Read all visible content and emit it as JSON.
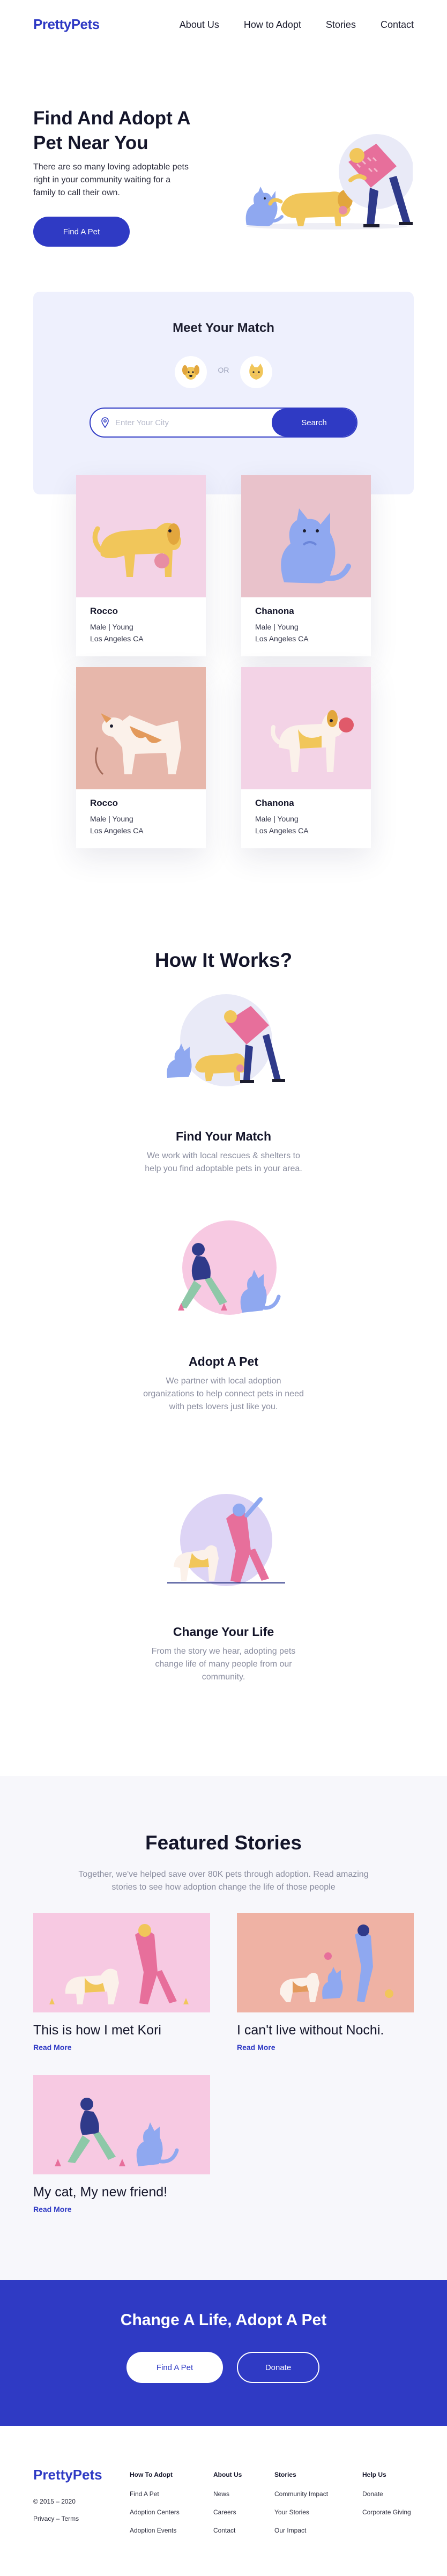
{
  "brand": {
    "logo": "PrettyPets"
  },
  "nav": {
    "items": [
      "About Us",
      "How to  Adopt",
      "Stories",
      "Contact"
    ]
  },
  "hero": {
    "title": "Find And Adopt A Pet Near You",
    "text": "There are so many loving adoptable pets right in your community waiting for a family to call their own.",
    "button": "Find A Pet"
  },
  "match": {
    "title": "Meet Your Match",
    "or_label": "OR",
    "search_placeholder": "Enter Your City",
    "search_button": "Search",
    "pet_icons": [
      "dog-icon",
      "cat-icon"
    ]
  },
  "pets": [
    {
      "name": "Rocco",
      "details": "Male |  Young",
      "location": "Los Angeles CA",
      "bg": "#f3d3e6"
    },
    {
      "name": "Chanona",
      "details": "Male |  Young",
      "location": "Los Angeles CA",
      "bg": "#e9c2cb"
    },
    {
      "name": "Rocco",
      "details": "Male |  Young",
      "location": "Los Angeles CA",
      "bg": "#e7b7ab"
    },
    {
      "name": "Chanona",
      "details": "Male |  Young",
      "location": "Los Angeles CA",
      "bg": "#f3d3e6"
    }
  ],
  "how": {
    "title": "How It Works?",
    "steps": [
      {
        "title": "Find Your Match",
        "text": "We work with local rescues & shelters to help you find adoptable pets in your area."
      },
      {
        "title": "Adopt A Pet",
        "text": "We partner with local adoption organizations to help connect pets in need with pets lovers just like you."
      },
      {
        "title": "Change Your Life",
        "text": "From the story we hear, adopting pets change life of many people from our community."
      }
    ]
  },
  "featured": {
    "title": "Featured Stories",
    "text": "Together, we've helped save over 80K pets through adoption.  Read amazing stories to see how adoption change the life of those people",
    "stories": [
      {
        "title": "This is how I met Kori",
        "link": "Read More"
      },
      {
        "title": "I can't live without Nochi.",
        "link": "Read More"
      },
      {
        "title": "My cat, My new friend!",
        "link": "Read More"
      }
    ]
  },
  "cta": {
    "title": "Change A Life, Adopt A Pet",
    "primary": "Find A Pet",
    "secondary": "Donate"
  },
  "footer": {
    "logo": "PrettyPets",
    "copyright": "© 2015 – 2020",
    "legal": "Privacy – Terms",
    "columns": [
      {
        "heading": "How To  Adopt",
        "links": [
          "Find A Pet",
          "Adoption Centers",
          "Adoption Events"
        ]
      },
      {
        "heading": "About Us",
        "links": [
          "News",
          "Careers",
          "Contact"
        ]
      },
      {
        "heading": "Stories",
        "links": [
          "Community Impact",
          "Your Stories",
          "Our Impact"
        ]
      },
      {
        "heading": "Help Us",
        "links": [
          "Donate",
          "Corporate Giving"
        ]
      }
    ]
  },
  "colors": {
    "accent": "#2f3ac4",
    "panel": "#eef0fd",
    "muted": "#8a8d9f"
  }
}
